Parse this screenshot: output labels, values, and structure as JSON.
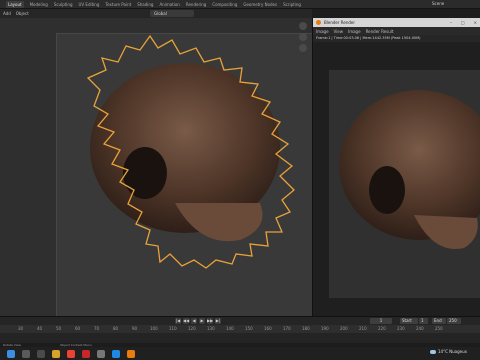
{
  "topbar": {
    "tabs": [
      "Layout",
      "Modeling",
      "Sculpting",
      "UV Editing",
      "Texture Paint",
      "Shading",
      "Animation",
      "Rendering",
      "Compositing",
      "Geometry Nodes",
      "Scripting"
    ],
    "scene": "Scene"
  },
  "viewport_header": {
    "items": [
      "Add",
      "Object"
    ],
    "orientation": "Global"
  },
  "render_window": {
    "title": "Blender Render",
    "menu": [
      "Image",
      "View",
      "Image"
    ],
    "slot": "Render Result",
    "info": "Frame:1 | Time:00:03.06 | Mem:1442.35M (Peak 1504.00M)"
  },
  "timeline": {
    "frame": "1",
    "start_label": "Start",
    "start": "1",
    "end_label": "End",
    "end": "250",
    "ticks": [
      "30",
      "40",
      "50",
      "60",
      "70",
      "80",
      "90",
      "100",
      "110",
      "120",
      "130",
      "140",
      "150",
      "160",
      "170",
      "180",
      "190",
      "200",
      "210",
      "220",
      "230",
      "240",
      "250"
    ]
  },
  "statusbar": {
    "left": "Rotate View",
    "center": "Object Context Menu"
  },
  "taskbar": {
    "weather": "14°C  Nuageux"
  },
  "colors": {
    "selection_outline": "#e8a23a",
    "accent": "#e87d0d"
  }
}
